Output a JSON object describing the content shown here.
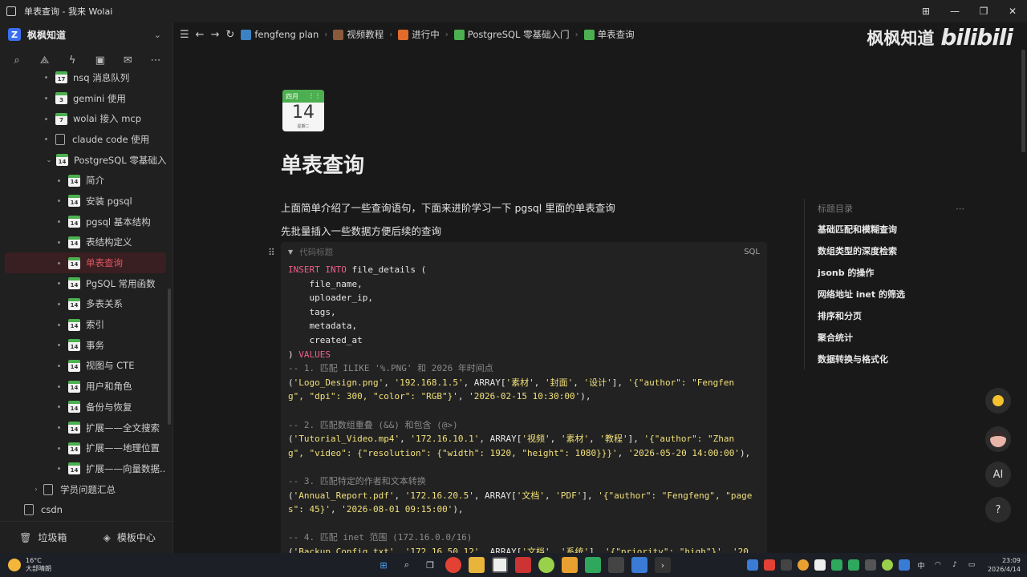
{
  "window": {
    "title": "单表查询 - 我来 Wolai"
  },
  "sidebar": {
    "workspace": "枫枫知道",
    "items": [
      {
        "label": "nsq 消息队列",
        "icon": "17",
        "level": 2
      },
      {
        "label": "gemini 使用",
        "icon": "3",
        "level": 2
      },
      {
        "label": "wolai 接入 mcp",
        "icon": "7",
        "level": 2
      },
      {
        "label": "claude code 使用",
        "icon": "doc",
        "level": 2
      },
      {
        "label": "PostgreSQL 零基础入...",
        "icon": "14",
        "level": 2,
        "expanded": true
      },
      {
        "label": "简介",
        "icon": "14",
        "level": 3
      },
      {
        "label": "安装 pgsql",
        "icon": "14",
        "level": 3
      },
      {
        "label": "pgsql 基本结构",
        "icon": "14",
        "level": 3
      },
      {
        "label": "表结构定义",
        "icon": "14",
        "level": 3
      },
      {
        "label": "单表查询",
        "icon": "14",
        "level": 3,
        "active": true
      },
      {
        "label": "PgSQL 常用函数",
        "icon": "14",
        "level": 3
      },
      {
        "label": "多表关系",
        "icon": "14",
        "level": 3
      },
      {
        "label": "索引",
        "icon": "14",
        "level": 3
      },
      {
        "label": "事务",
        "icon": "14",
        "level": 3
      },
      {
        "label": "视图与 CTE",
        "icon": "14",
        "level": 3
      },
      {
        "label": "用户和角色",
        "icon": "14",
        "level": 3
      },
      {
        "label": "备份与恢复",
        "icon": "14",
        "level": 3
      },
      {
        "label": "扩展——全文搜索",
        "icon": "14",
        "level": 3
      },
      {
        "label": "扩展——地理位置",
        "icon": "14",
        "level": 3
      },
      {
        "label": "扩展——向量数据...",
        "icon": "14",
        "level": 3
      },
      {
        "label": "学员问题汇总",
        "icon": "doc",
        "level": 1,
        "collapsed": true
      },
      {
        "label": "csdn",
        "icon": "doc",
        "level": 0
      }
    ],
    "footer": {
      "trash": "垃圾箱",
      "templates": "模板中心"
    }
  },
  "breadcrumb": [
    {
      "label": "fengfeng plan",
      "color": "#3b82c4"
    },
    {
      "label": "视频教程",
      "color": "#8a5a3a"
    },
    {
      "label": "进行中",
      "color": "#e06b2a"
    },
    {
      "label": "PostgreSQL 零基础入门",
      "color": "#4caf50"
    },
    {
      "label": "单表查询",
      "color": "#4caf50"
    }
  ],
  "watermark": {
    "text": "枫枫知道",
    "brand": "bilibili"
  },
  "page": {
    "icon": {
      "month": "四月",
      "day": "14",
      "weekday": "星期二"
    },
    "title": "单表查询",
    "para1": "上面简单介绍了一些查询语句，下面来进阶学习一下 pgsql 里面的单表查询",
    "para2": "先批量插入一些数据方便后续的查询",
    "code": {
      "caption": "代码标题",
      "lang": "SQL"
    }
  },
  "toc": {
    "header": "标题目录",
    "items": [
      "基础匹配和模糊查询",
      "数组类型的深度检索",
      "jsonb 的操作",
      "网络地址 inet 的筛选",
      "排序和分页",
      "聚合统计",
      "数据转换与格式化"
    ]
  },
  "taskbar": {
    "temp": "16°C",
    "weather": "大部晴朗",
    "time": "23:09",
    "date": "2026/4/14",
    "ime": "中"
  },
  "colors": {
    "accent_red": "#e05560",
    "keyword": "#f0608a",
    "string": "#f1e07a",
    "green": "#4caf50"
  }
}
